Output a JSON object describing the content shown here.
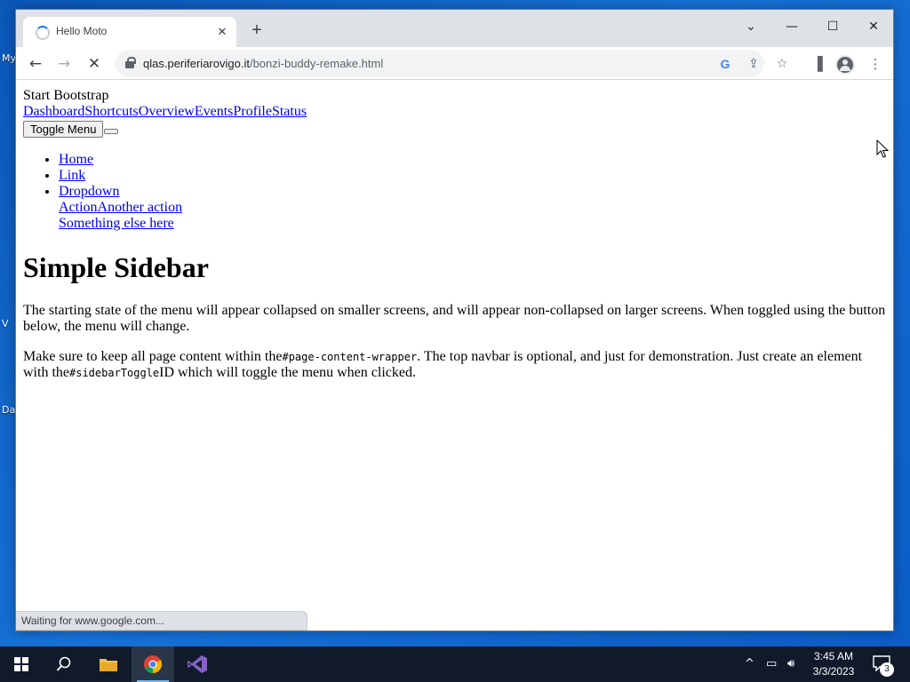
{
  "desktop": {
    "icon_labels": [
      "My",
      "V",
      "Da"
    ]
  },
  "browser": {
    "tab": {
      "title": "Hello Moto"
    },
    "url": {
      "host": "qlas.periferiarovigo.it",
      "path": "/bonzi-buddy-remake.html"
    },
    "status_bubble": "Waiting for www.google.com...",
    "icons": {
      "tab_close": "close-icon",
      "new_tab": "plus-icon",
      "back": "back-arrow-icon",
      "forward": "forward-arrow-icon",
      "stop": "stop-loading-icon",
      "google_lens": "google-icon",
      "share": "share-icon",
      "bookmark": "star-icon",
      "side_panel": "side-panel-icon",
      "profile": "profile-icon",
      "menu": "kebab-menu-icon"
    }
  },
  "page": {
    "brand": "Start Bootstrap",
    "topnav": [
      "Dashboard",
      "Shortcuts",
      "Overview",
      "Events",
      "Profile",
      "Status"
    ],
    "toggle_button": "Toggle Menu",
    "menu": {
      "home": "Home",
      "link": "Link",
      "dropdown": "Dropdown",
      "dropdown_items": [
        "Action",
        "Another action",
        "Something else here"
      ]
    },
    "heading": "Simple Sidebar",
    "paragraph1": "The starting state of the menu will appear collapsed on smaller screens, and will appear non-collapsed on larger screens. When toggled using the button below, the menu will change.",
    "paragraph2": {
      "part1": "Make sure to keep all page content within the",
      "code1": "#page-content-wrapper",
      "part2": ". The top navbar is optional, and just for demonstration. Just create an element with the",
      "code2": "#sidebarToggle",
      "part3": "ID which will toggle the menu when clicked."
    }
  },
  "taskbar": {
    "time": "3:45 AM",
    "date": "3/3/2023",
    "notification_count": "3",
    "accent": "#76b9ed"
  }
}
